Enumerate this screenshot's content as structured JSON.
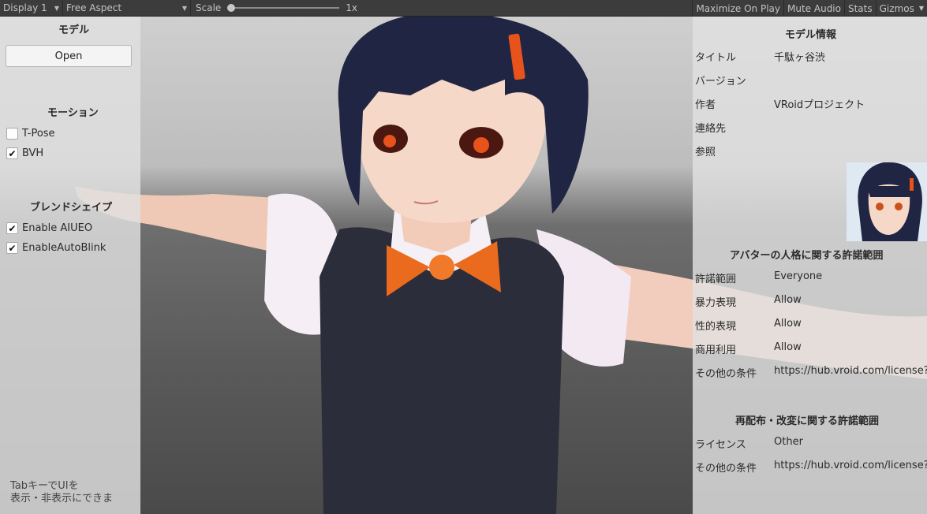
{
  "toolbar": {
    "display": "Display 1",
    "aspect": "Free Aspect",
    "scale_label": "Scale",
    "scale_value": "1x",
    "scale_level": 0.0,
    "maximize": "Maximize On Play",
    "mute": "Mute Audio",
    "stats": "Stats",
    "gizmos": "Gizmos"
  },
  "left": {
    "model_title": "モデル",
    "open_label": "Open",
    "motion_title": "モーション",
    "motions": [
      {
        "label": "T-Pose",
        "checked": false
      },
      {
        "label": "BVH",
        "checked": true
      }
    ],
    "blend_title": "ブレンドシェイプ",
    "blends": [
      {
        "label": "Enable AIUEO",
        "checked": true
      },
      {
        "label": "EnableAutoBlink",
        "checked": true
      }
    ],
    "hint_line1": "TabキーでUIを",
    "hint_line2": "表示・非表示にできま"
  },
  "right": {
    "info_title": "モデル情報",
    "info": [
      {
        "k": "タイトル",
        "v": "千駄ヶ谷渋"
      },
      {
        "k": "バージョン",
        "v": ""
      },
      {
        "k": "作者",
        "v": "VRoidプロジェクト"
      },
      {
        "k": "連絡先",
        "v": ""
      },
      {
        "k": "参照",
        "v": ""
      }
    ],
    "persona_title": "アバターの人格に関する許諾範囲",
    "persona": [
      {
        "k": "許諾範囲",
        "v": "Everyone"
      },
      {
        "k": "暴力表現",
        "v": "Allow"
      },
      {
        "k": "性的表現",
        "v": "Allow"
      },
      {
        "k": "商用利用",
        "v": "Allow"
      },
      {
        "k": "その他の条件",
        "v": "https://hub.vroid.com/license?a"
      }
    ],
    "redist_title": "再配布・改変に関する許諾範囲",
    "redist": [
      {
        "k": "ライセンス",
        "v": "Other"
      },
      {
        "k": "その他の条件",
        "v": "https://hub.vroid.com/license?a"
      }
    ]
  }
}
